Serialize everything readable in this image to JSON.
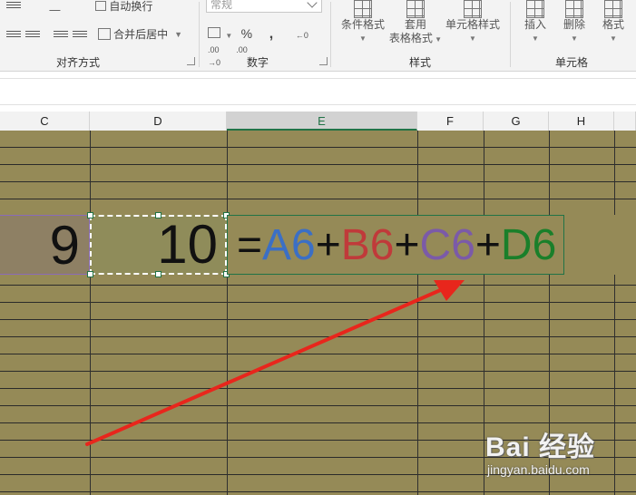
{
  "ribbon": {
    "alignment": {
      "wrap_text": "自动换行",
      "merge_center": "合并后居中",
      "group_label": "对齐方式"
    },
    "number": {
      "format_value": "常规",
      "percent": "%",
      "comma": ",",
      "group_label": "数字"
    },
    "styles": {
      "conditional": "条件格式",
      "table_format_1": "套用",
      "table_format_2": "表格格式",
      "cell_styles": "单元格样式",
      "group_label": "样式"
    },
    "cells": {
      "insert": "插入",
      "delete": "删除",
      "format": "格式",
      "group_label": "单元格"
    }
  },
  "columns": [
    "C",
    "D",
    "E",
    "F",
    "G",
    "H"
  ],
  "selected_column": "E",
  "row6": {
    "c_value": "9",
    "d_value": "10",
    "formula_parts": [
      {
        "text": "=",
        "color": "#111111"
      },
      {
        "text": "A6",
        "color": "#3b6fc5"
      },
      {
        "text": "+",
        "color": "#111111"
      },
      {
        "text": "B6",
        "color": "#c03a3a"
      },
      {
        "text": "+",
        "color": "#111111"
      },
      {
        "text": "C6",
        "color": "#7b5aa8"
      },
      {
        "text": "+",
        "color": "#111111"
      },
      {
        "text": "D6",
        "color": "#1a7f2a"
      }
    ]
  },
  "colors": {
    "sheet_fill": "#958a57",
    "accent": "#217346",
    "arrow": "#e8261c"
  },
  "watermark": {
    "logo": "Bai 经验",
    "url": "jingyan.baidu.com"
  }
}
